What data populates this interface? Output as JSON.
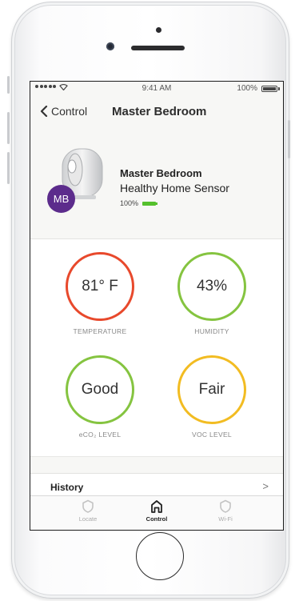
{
  "status_bar": {
    "time": "9:41 AM",
    "battery": "100%"
  },
  "nav": {
    "back_label": "Control",
    "title": "Master Bedroom"
  },
  "device": {
    "name": "Master Bedroom",
    "type": "Healthy Home Sensor",
    "battery": "100%",
    "avatar_initials": "MB",
    "avatar_color": "#5c2c8c",
    "battery_color": "#55c02d"
  },
  "metrics": {
    "temperature": {
      "value": "81° F",
      "label": "TEMPERATURE",
      "color": "#e8492c"
    },
    "humidity": {
      "value": "43%",
      "label": "HUMIDITY",
      "color": "#85c440"
    },
    "eco2": {
      "value": "Good",
      "label": "eCO₂ LEVEL",
      "color": "#85c440"
    },
    "voc": {
      "value": "Fair",
      "label": "VOC LEVEL",
      "color": "#f2bc22"
    }
  },
  "history": {
    "label": "History",
    "chevron": ">"
  },
  "tabs": [
    {
      "label": "Locate",
      "icon": "shield-icon"
    },
    {
      "label": "Control",
      "icon": "house-icon",
      "active": true
    },
    {
      "label": "Wi-Fi",
      "icon": "shield-icon"
    }
  ]
}
